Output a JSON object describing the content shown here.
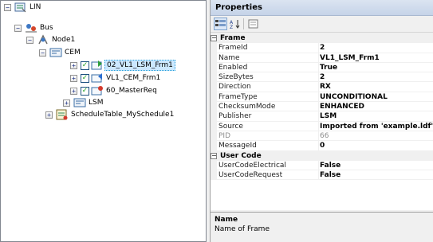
{
  "tree": {
    "nodes": [
      {
        "label": "LIN",
        "expander": "⊟",
        "icon": "lin-network-icon"
      },
      {
        "label": "Bus",
        "expander": "⊟",
        "icon": "bus-icon"
      },
      {
        "label": "Node1",
        "expander": "⊟",
        "icon": "node-icon"
      },
      {
        "label": "CEM",
        "expander": "⊟",
        "icon": "ecu-icon"
      },
      {
        "label": "02_VL1_LSM_Frm1",
        "expander": "⊞",
        "icon": "frame-receive-icon",
        "checked": true,
        "selected": true
      },
      {
        "label": "VL1_CEM_Frm1",
        "expander": "⊞",
        "icon": "frame-transmit-icon",
        "checked": true
      },
      {
        "label": "60_MasterReq",
        "expander": "⊞",
        "icon": "frame-diag-icon",
        "checked": true
      },
      {
        "label": "LSM",
        "expander": "⊞",
        "icon": "ecu-icon"
      },
      {
        "label": "ScheduleTable_MySchedule1",
        "expander": "⊞",
        "icon": "schedule-table-icon"
      }
    ]
  },
  "properties": {
    "title": "Properties",
    "toolbar": [
      "categorized-sort-icon",
      "alphabetical-sort-icon",
      "property-pages-icon"
    ],
    "categories": [
      {
        "name": "Frame",
        "toggle": "⊟",
        "rows": [
          {
            "name": "FrameId",
            "value": "2"
          },
          {
            "name": "Name",
            "value": "VL1_LSM_Frm1"
          },
          {
            "name": "Enabled",
            "value": "True"
          },
          {
            "name": "SizeBytes",
            "value": "2"
          },
          {
            "name": "Direction",
            "value": "RX"
          },
          {
            "name": "FrameType",
            "value": "UNCONDITIONAL"
          },
          {
            "name": "ChecksumMode",
            "value": "ENHANCED"
          },
          {
            "name": "Publisher",
            "value": "LSM"
          },
          {
            "name": "Source",
            "value": "Imported from 'example.ldf' at"
          },
          {
            "name": "PID",
            "value": "66",
            "disabled": true
          },
          {
            "name": "MessageId",
            "value": "0"
          }
        ]
      },
      {
        "name": "User Code",
        "toggle": "⊟",
        "rows": [
          {
            "name": "UserCodeElectrical",
            "value": "False"
          },
          {
            "name": "UserCodeRequest",
            "value": "False"
          }
        ]
      }
    ],
    "description": {
      "title": "Name",
      "text": "Name of Frame"
    }
  }
}
